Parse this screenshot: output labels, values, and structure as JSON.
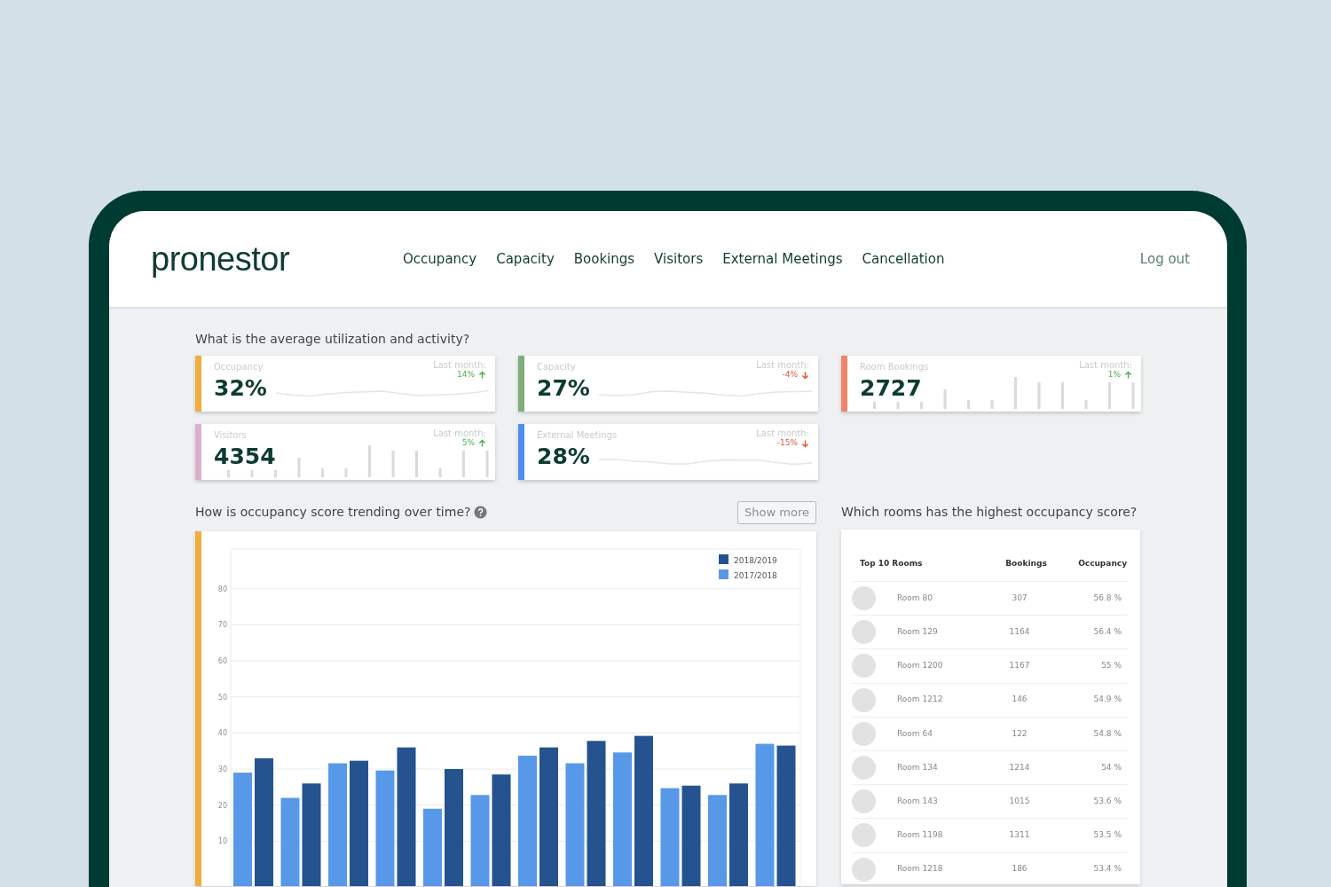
{
  "brand": "pronestor",
  "nav": [
    {
      "label": "Occupancy"
    },
    {
      "label": "Capacity"
    },
    {
      "label": "Bookings"
    },
    {
      "label": "Visitors"
    },
    {
      "label": "External Meetings"
    },
    {
      "label": "Cancellation"
    }
  ],
  "logout": "Log out",
  "summary": {
    "question": "What is the average utilization and activity?",
    "cards": [
      {
        "title": "Occupancy",
        "value": "32%",
        "last_month": "Last month:",
        "change": "14%",
        "increase": true,
        "color": "#f0ad3c",
        "kind": "line"
      },
      {
        "title": "Capacity",
        "value": "27%",
        "last_month": "Last month:",
        "change": "-4%",
        "increase": false,
        "color": "#7fae7a",
        "kind": "line"
      },
      {
        "title": "Room Bookings",
        "value": "2727",
        "last_month": "Last month:",
        "change": "1%",
        "increase": true,
        "color": "#ef846b",
        "kind": "bars"
      },
      {
        "title": "Visitors",
        "value": "4354",
        "last_month": "Last month:",
        "change": "5%",
        "increase": true,
        "color": "#dcafd0",
        "kind": "bars"
      },
      {
        "title": "External Meetings",
        "value": "28%",
        "last_month": "Last month:",
        "change": "-15%",
        "increase": false,
        "color": "#4f8ef0",
        "kind": "line"
      }
    ]
  },
  "trend": {
    "question": "How is occupancy score trending over time?",
    "show_more": "Show more",
    "chart_data": {
      "type": "bar",
      "grid": true,
      "legend": true,
      "ylim": [
        0,
        91
      ],
      "yticks": [
        10,
        20,
        30,
        40,
        50,
        60,
        70,
        80
      ],
      "series": [
        {
          "name": "2018/2019",
          "color": "#24538f",
          "values": [
            33,
            26,
            32.3,
            36,
            30,
            28.5,
            36,
            37.8,
            39.2,
            25.4,
            26,
            36.5
          ]
        },
        {
          "name": "2017/2018",
          "color": "#5898e8",
          "values": [
            29,
            22,
            31.6,
            29.6,
            19,
            22.8,
            33.7,
            31.6,
            34.6,
            24.7,
            22.8,
            37
          ]
        }
      ]
    }
  },
  "rooms": {
    "question": "Which rooms has the highest occupancy score?",
    "columns": [
      "Top 10 Rooms",
      "Bookings",
      "Occupancy"
    ],
    "rows": [
      {
        "name": "Room 80",
        "bookings": "307",
        "occupancy": "56.8 %"
      },
      {
        "name": "Room 129",
        "bookings": "1164",
        "occupancy": "56.4 %"
      },
      {
        "name": "Room 1200",
        "bookings": "1167",
        "occupancy": "55 %"
      },
      {
        "name": "Room 1212",
        "bookings": "146",
        "occupancy": "54.9 %"
      },
      {
        "name": "Room 64",
        "bookings": "122",
        "occupancy": "54.8 %"
      },
      {
        "name": "Room 134",
        "bookings": "1214",
        "occupancy": "54 %"
      },
      {
        "name": "Room 143",
        "bookings": "1015",
        "occupancy": "53.6 %"
      },
      {
        "name": "Room 1198",
        "bookings": "1311",
        "occupancy": "53.5 %"
      },
      {
        "name": "Room 1218",
        "bookings": "186",
        "occupancy": "53.4 %"
      }
    ]
  }
}
